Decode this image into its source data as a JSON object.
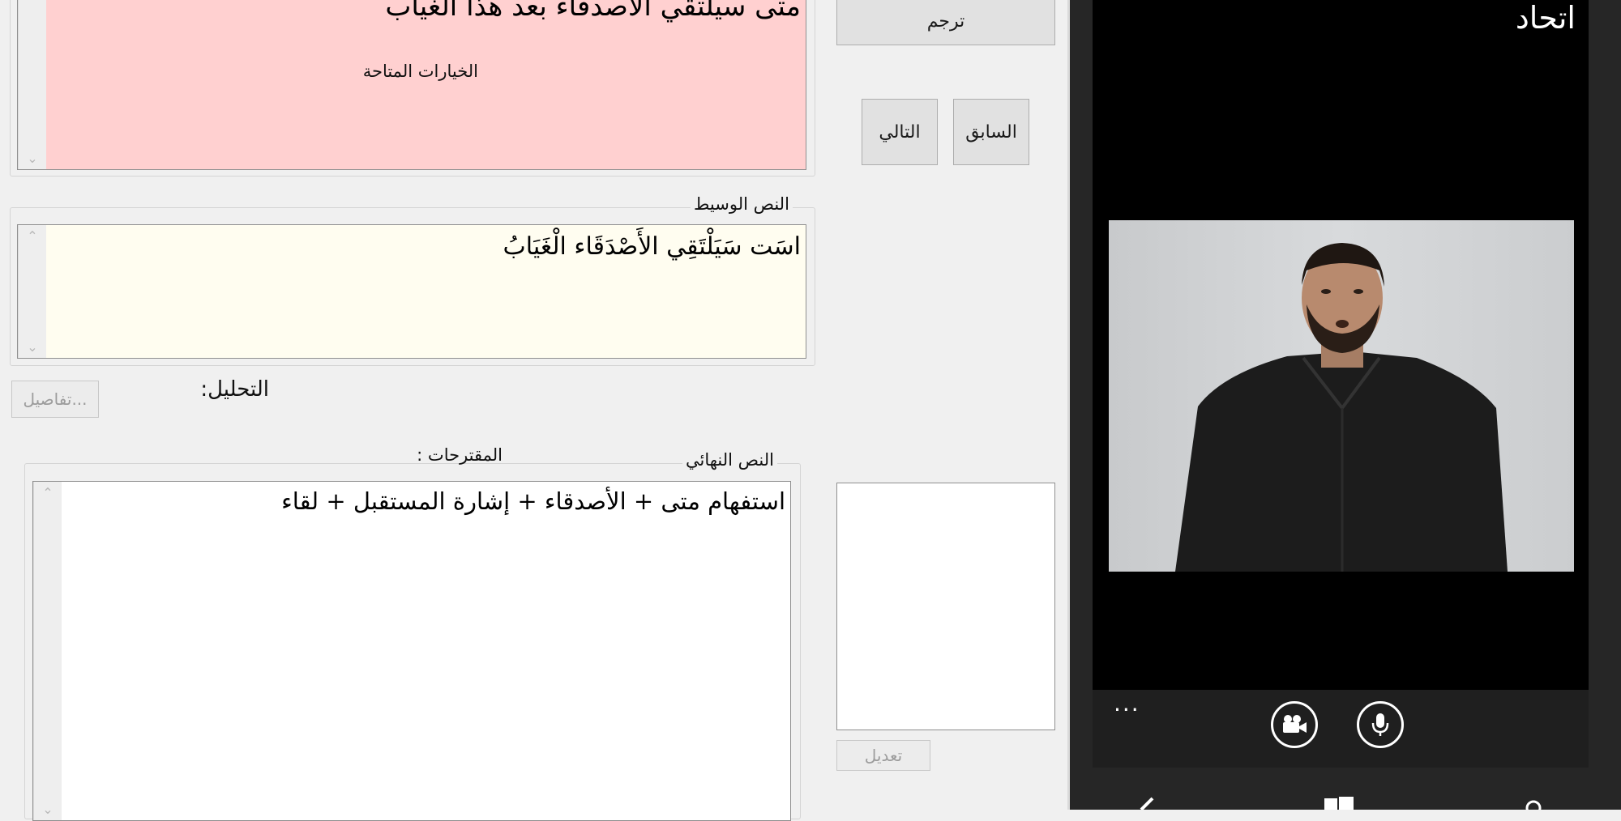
{
  "source_text": {
    "value": "متى سيلتقي الأصدقاء بعد هذا الغياب"
  },
  "buttons": {
    "translate": "ترجم",
    "previous": "السابق",
    "next": "التالي",
    "details": "تفاصيل...",
    "edit": "تعديل"
  },
  "labels": {
    "options": "الخيارات المتاحة",
    "analysis": "التحليل:",
    "suggestions": "المقترحات :"
  },
  "intermediate": {
    "legend": "النص الوسيط",
    "value": "اسَت سَيَلْتَقِي الأَصْدَقَاء   الْغَيَابُ"
  },
  "final": {
    "legend": "النص النهائي",
    "value": "استفهام متى + الأصدقاء + إشارة المستقبل + لقاء"
  },
  "phone": {
    "title": "اتحاد",
    "more": "...",
    "icons": [
      "video-camera-icon",
      "microphone-icon"
    ]
  },
  "colors": {
    "source_bg": "#ffd0d0",
    "intermediate_bg": "#fffdf0",
    "final_bg": "#ffffff",
    "form_bg": "#f0f0f0",
    "phone_bg": "#000000"
  }
}
